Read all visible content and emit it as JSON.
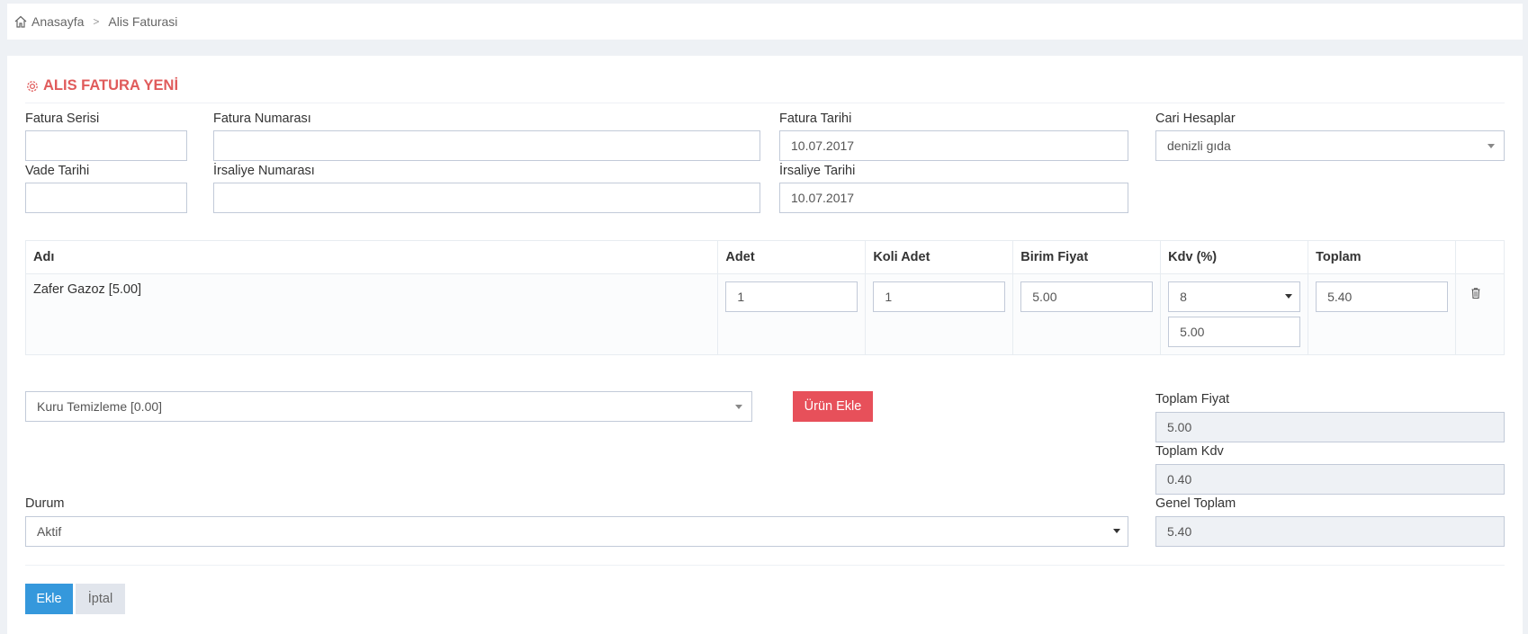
{
  "breadcrumb": {
    "home": "Anasayfa",
    "current": "Alis Faturasi"
  },
  "page": {
    "title": "ALIS FATURA YENİ"
  },
  "form": {
    "fatura_serisi": {
      "label": "Fatura Serisi",
      "value": ""
    },
    "fatura_numarasi": {
      "label": "Fatura Numarası",
      "value": ""
    },
    "fatura_tarihi": {
      "label": "Fatura Tarihi",
      "value": "10.07.2017"
    },
    "cari_hesaplar": {
      "label": "Cari Hesaplar",
      "value": "denizli gıda"
    },
    "vade_tarihi": {
      "label": "Vade Tarihi",
      "value": ""
    },
    "irsaliye_numarasi": {
      "label": "İrsaliye Numarası",
      "value": ""
    },
    "irsaliye_tarihi": {
      "label": "İrsaliye Tarihi",
      "value": "10.07.2017"
    }
  },
  "table": {
    "headers": [
      "Adı",
      "Adet",
      "Koli Adet",
      "Birim Fiyat",
      "Kdv (%)",
      "Toplam",
      ""
    ],
    "rows": [
      {
        "name": "Zafer Gazoz [5.00]",
        "adet": "1",
        "koli_adet": "1",
        "birim_fiyat": "5.00",
        "kdv": "8",
        "kdv_amount": "5.00",
        "toplam": "5.40"
      }
    ]
  },
  "product_select": {
    "value": "Kuru Temizleme [0.00]"
  },
  "add_product_button": "Ürün Ekle",
  "totals": {
    "toplam_fiyat": {
      "label": "Toplam Fiyat",
      "value": "5.00"
    },
    "toplam_kdv": {
      "label": "Toplam Kdv",
      "value": "0.40"
    },
    "genel_toplam": {
      "label": "Genel Toplam",
      "value": "5.40"
    }
  },
  "durum": {
    "label": "Durum",
    "value": "Aktif"
  },
  "actions": {
    "submit": "Ekle",
    "cancel": "İptal"
  },
  "colors": {
    "accent_red": "#e05b5b",
    "button_red": "#e7505a",
    "button_blue": "#3598dc"
  }
}
